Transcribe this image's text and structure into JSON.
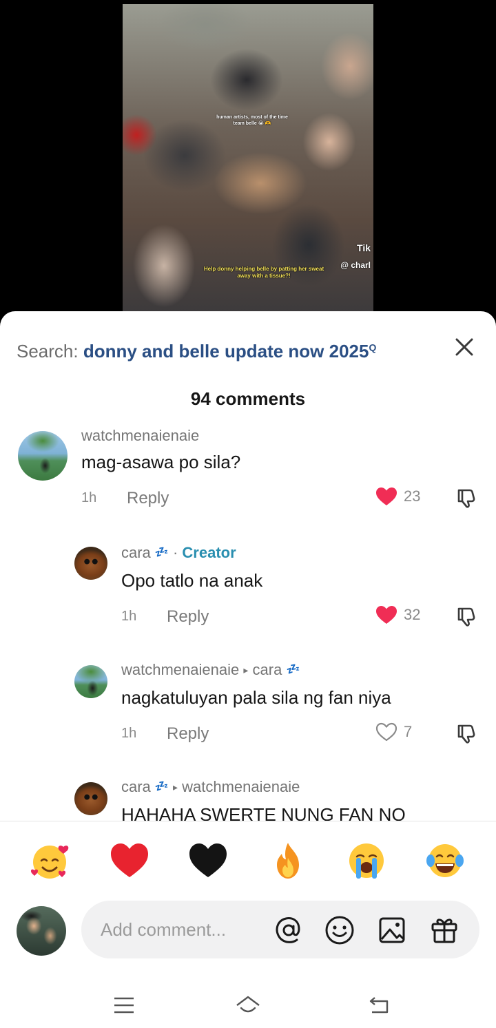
{
  "video": {
    "caption_top": "human artists, most of the time team belle 😭 🫶",
    "caption_bottom": "Help donny helping belle by patting her sweat away with a tissue?!",
    "watermark_logo": "Tik",
    "watermark_handle": "@ charl"
  },
  "search": {
    "label": "Search: ",
    "query": "donny and belle update now 2025",
    "icon": "search-icon"
  },
  "close_icon": "close-icon",
  "comments_header": "94 comments",
  "comments": [
    {
      "username": "watchmenaienaie",
      "text": "mag-asawa po sila?",
      "time": "1h",
      "reply_label": "Reply",
      "likes": "23",
      "liked": true
    },
    {
      "username": "cara",
      "sleep_badge": "💤",
      "separator": "·",
      "creator_label": "Creator",
      "text": "Opo tatlo na anak",
      "time": "1h",
      "reply_label": "Reply",
      "likes": "32",
      "liked": true
    },
    {
      "username": "watchmenaienaie",
      "reply_arrow": "▸",
      "reply_to": "cara",
      "reply_to_badge": "💤",
      "text": "nagkatuluyan pala sila ng fan niya",
      "time": "1h",
      "reply_label": "Reply",
      "likes": "7",
      "liked": false
    },
    {
      "username": "cara",
      "sleep_badge": "💤",
      "reply_arrow": "▸",
      "reply_to": "watchmenaienaie",
      "text": "HAHAHA SWERTE NUNG FAN NO"
    }
  ],
  "quick_emojis": [
    "smiling-face-with-hearts",
    "red-heart",
    "black-heart",
    "fire",
    "loudly-crying-face",
    "face-with-tears-of-joy"
  ],
  "input": {
    "placeholder": "Add comment...",
    "icons": [
      "mention-icon",
      "emoji-icon",
      "image-icon",
      "gift-icon"
    ]
  },
  "colors": {
    "accent_link": "#2b4f84",
    "creator": "#2a8fb0",
    "like_red": "#f02d55",
    "muted": "#8a8a8a"
  },
  "system_nav": [
    "menu-icon",
    "home-icon",
    "back-icon"
  ]
}
